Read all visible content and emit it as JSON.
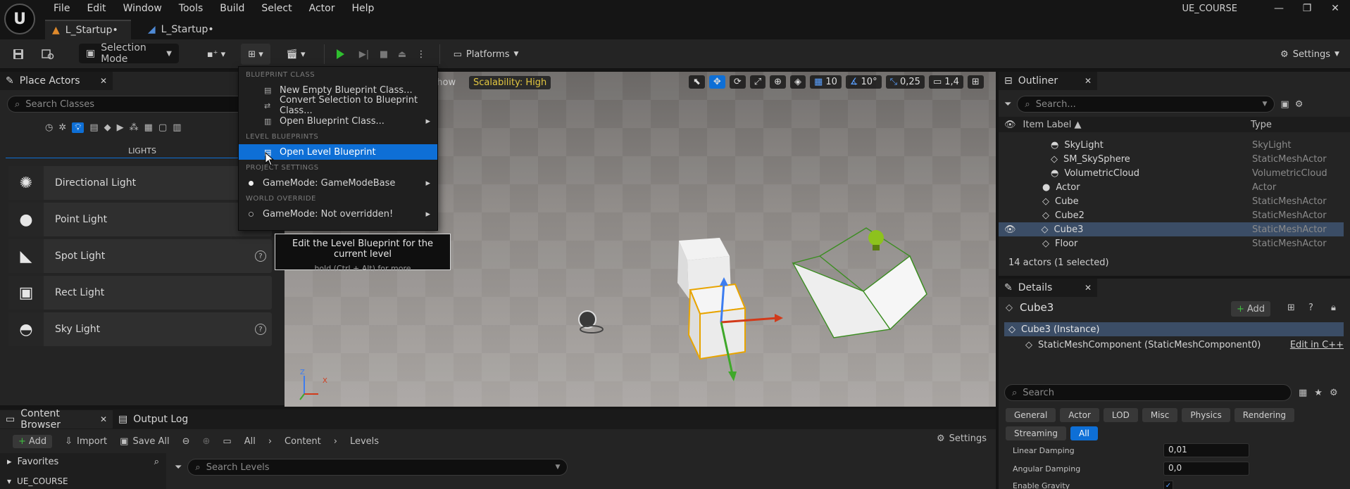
{
  "window": {
    "logo_text": "U",
    "menu": [
      "File",
      "Edit",
      "Window",
      "Tools",
      "Build",
      "Select",
      "Actor",
      "Help"
    ],
    "project_name": "UE_COURSE",
    "controls": {
      "minimize": "—",
      "restore": "❐",
      "close": "✕"
    }
  },
  "tabs": [
    {
      "label": "L_Startup•",
      "active": true
    },
    {
      "label": "L_Startup•",
      "active": false
    }
  ],
  "toolbar": {
    "selection_mode": "Selection Mode",
    "platforms": "Platforms",
    "settings": "Settings"
  },
  "place_actors": {
    "title": "Place Actors",
    "search_placeholder": "Search Classes",
    "category_heading": "LIGHTS",
    "items": [
      {
        "label": "Directional Light",
        "icon": "sun-icon"
      },
      {
        "label": "Point Light",
        "icon": "bulb-icon"
      },
      {
        "label": "Spot Light",
        "icon": "spotlight-icon"
      },
      {
        "label": "Rect Light",
        "icon": "rect-light-icon"
      },
      {
        "label": "Sky Light",
        "icon": "sky-light-icon"
      }
    ]
  },
  "viewport": {
    "show_label": "Show",
    "scalability": "Scalability: High",
    "grid_snap": "10",
    "rotation_snap": "10°",
    "scale_snap": "0,25",
    "camera_speed": "1,4",
    "axis_x": "X",
    "axis_z": "Z"
  },
  "blueprint_menu": {
    "sections": {
      "blueprint_class": "BLUEPRINT CLASS",
      "level_blueprints": "LEVEL BLUEPRINTS",
      "project_settings": "PROJECT SETTINGS",
      "world_override": "WORLD OVERRIDE"
    },
    "new_empty": "New Empty Blueprint Class...",
    "convert_selection": "Convert Selection to Blueprint Class...",
    "open_blueprint_class": "Open Blueprint Class...",
    "open_level_blueprint": "Open Level Blueprint",
    "gamemode_project": "GameMode: GameModeBase",
    "gamemode_world": "GameMode: Not overridden!"
  },
  "tooltip": {
    "main": "Edit the Level Blueprint for the current level",
    "hint": "hold (Ctrl + Alt) for more"
  },
  "outliner": {
    "title": "Outliner",
    "search_placeholder": "Search...",
    "col_label": "Item Label ▲",
    "col_type": "Type",
    "rows": [
      {
        "label": "SkyLight",
        "type": "SkyLight",
        "indent": 2,
        "selected": false
      },
      {
        "label": "SM_SkySphere",
        "type": "StaticMeshActor",
        "indent": 2,
        "selected": false
      },
      {
        "label": "VolumetricCloud",
        "type": "VolumetricCloud",
        "indent": 2,
        "selected": false
      },
      {
        "label": "Actor",
        "type": "Actor",
        "indent": 1,
        "selected": false
      },
      {
        "label": "Cube",
        "type": "StaticMeshActor",
        "indent": 1,
        "selected": false
      },
      {
        "label": "Cube2",
        "type": "StaticMeshActor",
        "indent": 1,
        "selected": false
      },
      {
        "label": "Cube3",
        "type": "StaticMeshActor",
        "indent": 1,
        "selected": true
      },
      {
        "label": "Floor",
        "type": "StaticMeshActor",
        "indent": 1,
        "selected": false
      }
    ],
    "status": "14 actors (1 selected)"
  },
  "details": {
    "title": "Details",
    "object_name": "Cube3",
    "add_label": "Add",
    "instance_label": "Cube3 (Instance)",
    "component_label": "StaticMeshComponent (StaticMeshComponent0)",
    "edit_cpp": "Edit in C++",
    "search_placeholder": "Search",
    "categories": [
      {
        "label": "General",
        "active": false
      },
      {
        "label": "Actor",
        "active": false
      },
      {
        "label": "LOD",
        "active": false
      },
      {
        "label": "Misc",
        "active": false
      },
      {
        "label": "Physics",
        "active": false
      },
      {
        "label": "Rendering",
        "active": false
      },
      {
        "label": "Streaming",
        "active": false
      },
      {
        "label": "All",
        "active": true
      }
    ],
    "props": [
      {
        "label": "Linear Damping",
        "value": "0,01"
      },
      {
        "label": "Angular Damping",
        "value": "0,0"
      },
      {
        "label": "Enable Gravity",
        "value": "✓"
      }
    ]
  },
  "content_browser": {
    "tab_title": "Content Browser",
    "output_log": "Output Log",
    "add": "Add",
    "import": "Import",
    "save_all": "Save All",
    "path": [
      "All",
      "Content",
      "Levels"
    ],
    "settings": "Settings",
    "favorites": "Favorites",
    "project_root": "UE_COURSE",
    "search_placeholder": "Search Levels"
  }
}
